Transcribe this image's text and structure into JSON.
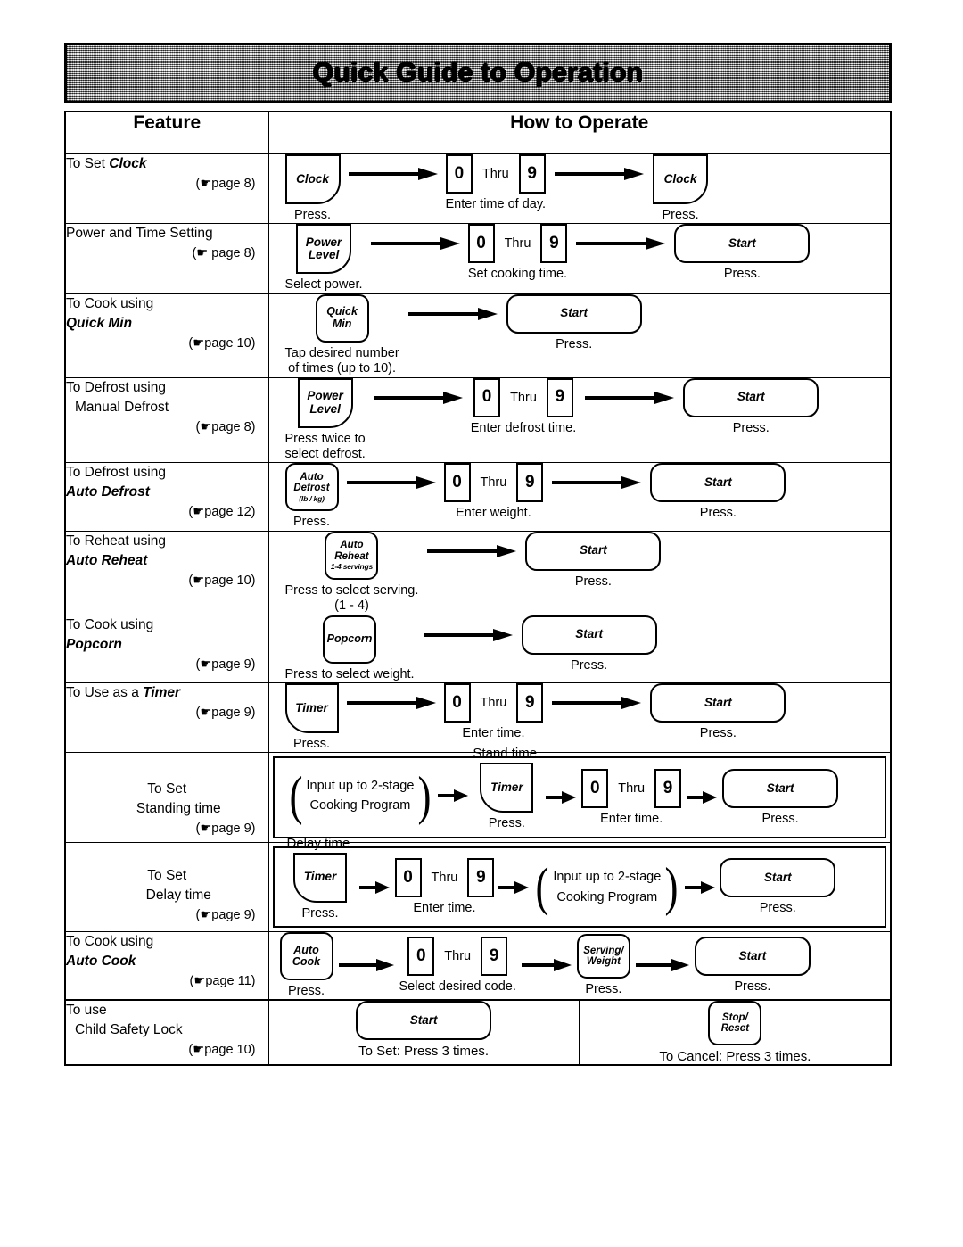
{
  "banner": {
    "title": "Quick Guide to Operation"
  },
  "table_headers": {
    "feature": "Feature",
    "how_to_operate": "How to Operate"
  },
  "labels": {
    "thru": "Thru",
    "press": "Press.",
    "key_zero": "0",
    "key_nine": "9",
    "hand_glyph": "☛"
  },
  "rows": [
    {
      "feature": {
        "line1": "To Set ",
        "emph": "Clock",
        "line2": "",
        "pageref": "(☛page 8)"
      },
      "steps": [
        {
          "button": "Clock",
          "caption": "Press."
        },
        {
          "button": "0 Thru 9",
          "caption": "Enter time of day."
        },
        {
          "button": "Clock",
          "caption": "Press."
        }
      ]
    },
    {
      "feature": {
        "line1": "Power and Time Setting",
        "emph": "",
        "line2": "",
        "pageref": "(☛ page 8)"
      },
      "steps": [
        {
          "button": "Power Level",
          "caption": "Select power."
        },
        {
          "button": "0 Thru 9",
          "caption": "Set cooking time."
        },
        {
          "button": "Start",
          "caption": "Press."
        }
      ]
    },
    {
      "feature": {
        "line1": "To Cook using",
        "emph": "Quick Min",
        "line2": "",
        "pageref": "(☛page 10)"
      },
      "steps": [
        {
          "button": "Quick Min",
          "caption": "Tap desired number\nof times (up to 10)."
        },
        {
          "button": "Start",
          "caption": "Press."
        }
      ]
    },
    {
      "feature": {
        "line1": "To Defrost using",
        "emph": "",
        "line2": "Manual Defrost",
        "pageref": "(☛page 8)"
      },
      "steps": [
        {
          "button": "Power Level",
          "caption": "Press twice to\nselect defrost."
        },
        {
          "button": "0 Thru 9",
          "caption": "Enter defrost time."
        },
        {
          "button": "Start",
          "caption": "Press."
        }
      ]
    },
    {
      "feature": {
        "line1": "To Defrost using",
        "emph": "Auto Defrost",
        "line2": "",
        "pageref": "(☛page 12)"
      },
      "steps": [
        {
          "button": "Auto Defrost (lb / kg)",
          "caption": "Press."
        },
        {
          "button": "0 Thru 9",
          "caption": "Enter weight."
        },
        {
          "button": "Start",
          "caption": "Press."
        }
      ]
    },
    {
      "feature": {
        "line1": "To Reheat using",
        "emph": "Auto Reheat",
        "line2": "",
        "pageref": "(☛page 10)"
      },
      "steps": [
        {
          "button": "Auto Reheat 1-4 servings",
          "caption": "Press to select serving.\n(1 - 4)"
        },
        {
          "button": "Start",
          "caption": "Press."
        }
      ]
    },
    {
      "feature": {
        "line1": "To Cook using",
        "emph": "Popcorn",
        "line2": "",
        "pageref": "(☛page 9)"
      },
      "steps": [
        {
          "button": "Popcorn",
          "caption": "Press to select weight."
        },
        {
          "button": "Start",
          "caption": "Press."
        }
      ]
    },
    {
      "feature": {
        "line1": "To Use as a ",
        "emph": "Timer",
        "line2": "",
        "pageref": "(☛page 9)"
      },
      "steps": [
        {
          "button": "Timer",
          "caption": "Press."
        },
        {
          "button": "0 Thru 9",
          "caption": "Enter time."
        },
        {
          "button": "Start",
          "caption": "Press."
        }
      ]
    },
    {
      "feature": {
        "line1": "To Set",
        "emph": "",
        "line2": "Standing time",
        "pageref": "(☛page 9)"
      },
      "steps": [
        {
          "button": "Input up to 2-stage\nCooking Program",
          "caption": ""
        },
        {
          "button": "Timer",
          "caption": "Press.",
          "toplabel": "Stand time."
        },
        {
          "button": "0 Thru 9",
          "caption": "Enter time."
        },
        {
          "button": "Start",
          "caption": "Press."
        }
      ]
    },
    {
      "feature": {
        "line1": "To Set",
        "emph": "",
        "line2": "Delay time",
        "pageref": "(☛page 9)"
      },
      "steps": [
        {
          "button": "Timer",
          "caption": "Press.",
          "toplabel": "Delay time."
        },
        {
          "button": "0 Thru 9",
          "caption": "Enter time."
        },
        {
          "button": "Input up to 2-stage\nCooking Program",
          "caption": ""
        },
        {
          "button": "Start",
          "caption": "Press."
        }
      ]
    },
    {
      "feature": {
        "line1": "To Cook using",
        "emph": "Auto Cook",
        "line2": "",
        "pageref": "(☛page 11)"
      },
      "steps": [
        {
          "button": "Auto Cook",
          "caption": "Press."
        },
        {
          "button": "0 Thru 9",
          "caption": "Select desired code."
        },
        {
          "button": "Serving/ Weight",
          "caption": "Press."
        },
        {
          "button": "Start",
          "caption": "Press."
        }
      ]
    },
    {
      "feature": {
        "line1": "To use",
        "emph": "",
        "line2": "Child Safety Lock",
        "pageref": "(☛page 10)"
      },
      "split": [
        {
          "button": "Start",
          "caption": "To Set: Press 3 times."
        },
        {
          "button": "Stop/ Reset",
          "caption": "To Cancel: Press 3 times."
        }
      ]
    }
  ],
  "button_text": {
    "clock": "Clock",
    "power": "Power",
    "level": "Level",
    "quick": "Quick",
    "min": "Min",
    "auto": "Auto",
    "defrost": "Defrost",
    "defrost_sub": "(lb / kg)",
    "reheat": "Reheat",
    "reheat_sub": "1-4 servings",
    "popcorn": "Popcorn",
    "timer": "Timer",
    "start": "Start",
    "cook": "Cook",
    "serving": "Serving/",
    "weight": "Weight",
    "stop": "Stop/",
    "reset": "Reset",
    "paren_note_l1": "Input up to 2-stage",
    "paren_note_l2": "Cooking Program"
  },
  "captions": {
    "press": "Press.",
    "enter_time_of_day": "Enter time of day.",
    "select_power": "Select power.",
    "set_cooking_time": "Set cooking time.",
    "tap_desired": "Tap desired number\nof times (up to 10).",
    "press_twice": "Press twice to\nselect defrost.",
    "enter_defrost_time": "Enter defrost time.",
    "enter_weight": "Enter weight.",
    "press_serving": "Press to select serving.\n(1 - 4)",
    "press_weight": "Press to select weight.",
    "enter_time": "Enter time.",
    "select_code": "Select desired code.",
    "stand_time": "Stand time.",
    "delay_time": "Delay time.",
    "to_set_3": "To Set: Press 3 times.",
    "to_cancel_3": "To Cancel: Press 3 times."
  }
}
